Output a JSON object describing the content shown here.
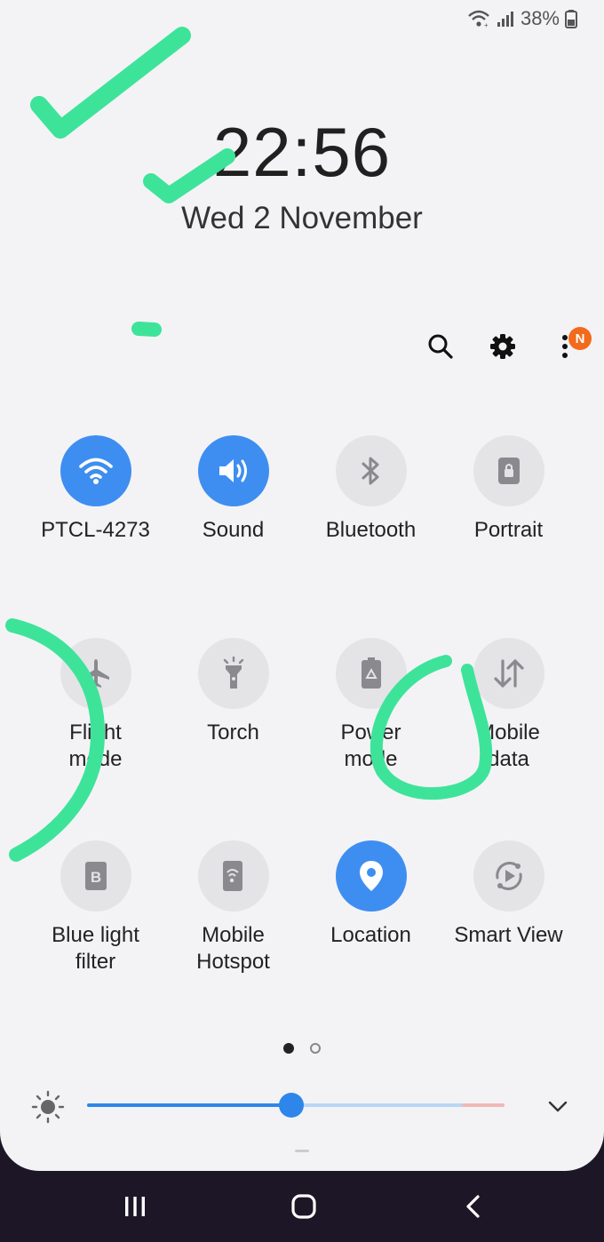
{
  "status_bar": {
    "battery_text": "38%",
    "icons": [
      "wifi-icon",
      "signal-icon",
      "battery-icon"
    ]
  },
  "lockscreen": {
    "time": "22:56",
    "date": "Wed 2 November"
  },
  "toolbar": {
    "icons": [
      "search-icon",
      "gear-icon",
      "more-vert-icon"
    ],
    "notification_badge": "N"
  },
  "quick_settings": {
    "tiles": [
      {
        "label": "PTCL-4273",
        "icon": "wifi-icon",
        "active": true
      },
      {
        "label": "Sound",
        "icon": "volume-icon",
        "active": true
      },
      {
        "label": "Bluetooth",
        "icon": "bluetooth-icon",
        "active": false
      },
      {
        "label": "Portrait",
        "icon": "portrait-lock-icon",
        "active": false
      },
      {
        "label": "Flight\nmode",
        "icon": "airplane-icon",
        "active": false
      },
      {
        "label": "Torch",
        "icon": "torch-icon",
        "active": false
      },
      {
        "label": "Power\nmode",
        "icon": "battery-recycle-icon",
        "active": false
      },
      {
        "label": "Mobile\ndata",
        "icon": "data-arrows-icon",
        "active": false
      },
      {
        "label": "Blue light\nfilter",
        "icon": "blue-light-icon",
        "active": false
      },
      {
        "label": "Mobile\nHotspot",
        "icon": "hotspot-icon",
        "active": false
      },
      {
        "label": "Location",
        "icon": "location-pin-icon",
        "active": true
      },
      {
        "label": "Smart View",
        "icon": "smart-view-icon",
        "active": false
      }
    ]
  },
  "pager": {
    "pages": 2,
    "current": 1
  },
  "brightness": {
    "level": 0.49
  },
  "navigation": {
    "buttons": [
      "recent-apps",
      "home",
      "back"
    ]
  },
  "colors": {
    "accent": "#3e8ef1",
    "panel": "#f3f3f5",
    "badge": "#f26a1b",
    "annotation": "#3ee39a"
  }
}
